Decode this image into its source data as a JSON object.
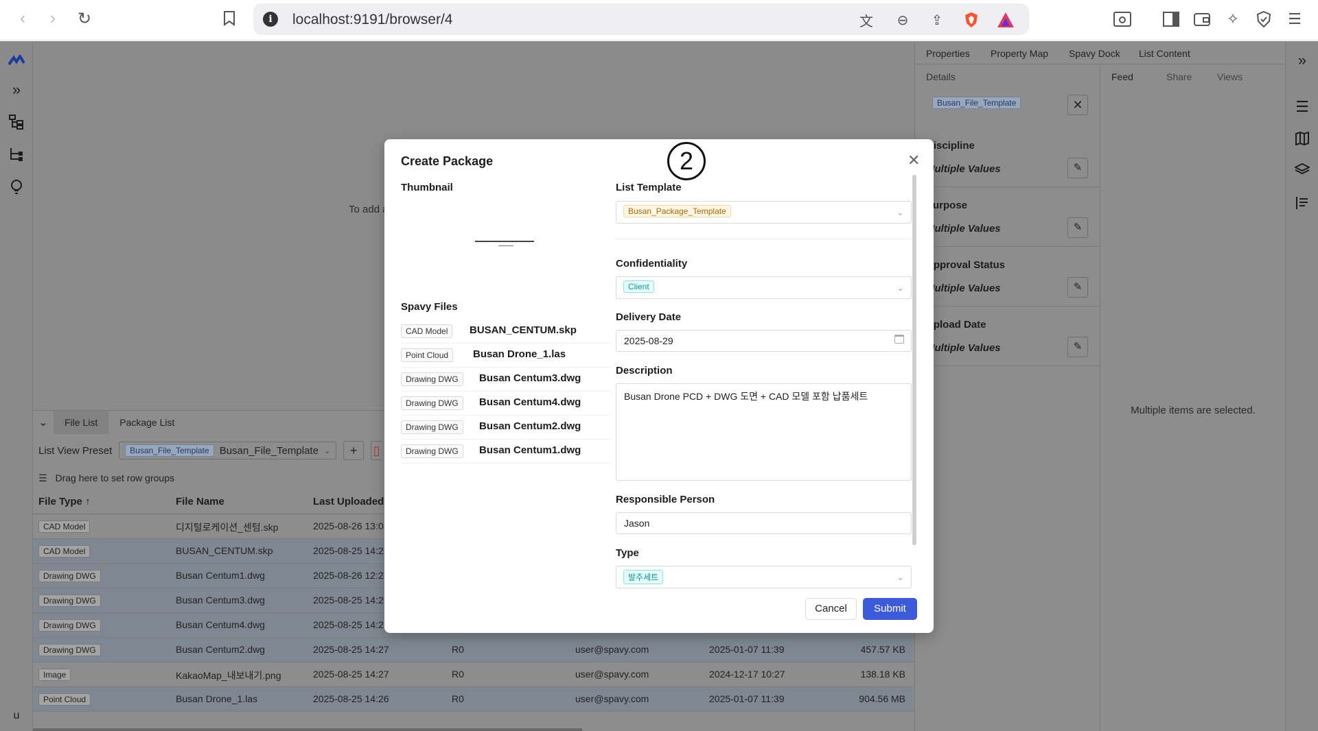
{
  "browser": {
    "url": "localhost:9191/browser/4"
  },
  "viewer": {
    "hint": "To add a"
  },
  "bottom_panel": {
    "tabs": [
      "File List",
      "Package List"
    ],
    "preset_label": "List View Preset",
    "preset_tag": "Busan_File_Template",
    "preset_value": "Busan_File_Template",
    "group_hint": "Drag here to set row groups",
    "columns": [
      "File Type",
      "File Name",
      "Last Uploaded"
    ],
    "rows": [
      {
        "type": "CAD Model",
        "name": "디지털로케이션_센텀.skp",
        "uploaded": "2025-08-26 13:0",
        "rev": "",
        "user": "",
        "date": "",
        "size": "",
        "selected": false
      },
      {
        "type": "CAD Model",
        "name": "BUSAN_CENTUM.skp",
        "uploaded": "2025-08-25 14:2",
        "rev": "",
        "user": "",
        "date": "",
        "size": "",
        "selected": true
      },
      {
        "type": "Drawing DWG",
        "name": "Busan Centum1.dwg",
        "uploaded": "2025-08-26 12:2",
        "rev": "",
        "user": "",
        "date": "",
        "size": "",
        "selected": true
      },
      {
        "type": "Drawing DWG",
        "name": "Busan Centum3.dwg",
        "uploaded": "2025-08-25 14:2",
        "rev": "",
        "user": "",
        "date": "",
        "size": "",
        "selected": true
      },
      {
        "type": "Drawing DWG",
        "name": "Busan Centum4.dwg",
        "uploaded": "2025-08-25 14:2",
        "rev": "",
        "user": "",
        "date": "",
        "size": "",
        "selected": true
      },
      {
        "type": "Drawing DWG",
        "name": "Busan Centum2.dwg",
        "uploaded": "2025-08-25 14:27",
        "rev": "R0",
        "user": "user@spavy.com",
        "date": "2025-01-07 11:39",
        "size": "457.57 KB",
        "selected": true
      },
      {
        "type": "Image",
        "name": "KakaoMap_내보내기.png",
        "uploaded": "2025-08-25 14:27",
        "rev": "R0",
        "user": "user@spavy.com",
        "date": "2024-12-17 10:27",
        "size": "138.18 KB",
        "selected": false
      },
      {
        "type": "Point Cloud",
        "name": "Busan Drone_1.las",
        "uploaded": "2025-08-25 14:26",
        "rev": "R0",
        "user": "user@spavy.com",
        "date": "2025-01-07 11:39",
        "size": "904.56 MB",
        "selected": true
      }
    ]
  },
  "right_panel": {
    "tabs": [
      "Properties",
      "Property Map",
      "Spavy Dock",
      "List Content"
    ],
    "sub_left": "Details",
    "sub_right": [
      "Feed",
      "Share",
      "Views"
    ],
    "template_tag": "Busan_File_Template",
    "properties": [
      {
        "name": "Discipline",
        "value": "Multiple Values"
      },
      {
        "name": "Purpose",
        "value": "Multiple Values"
      },
      {
        "name": "Approval Status",
        "value": "Multiple Values"
      },
      {
        "name": "Upload Date",
        "value": "Multiple Values"
      }
    ],
    "message": "Multiple items are selected."
  },
  "left_rail": {
    "bottom_letter": "u"
  },
  "modal": {
    "title": "Create Package",
    "step_marker": "2",
    "thumbnail_label": "Thumbnail",
    "spavy_files_label": "Spavy Files",
    "files": [
      {
        "type": "CAD Model",
        "name": "BUSAN_CENTUM.skp"
      },
      {
        "type": "Point Cloud",
        "name": "Busan Drone_1.las"
      },
      {
        "type": "Drawing DWG",
        "name": "Busan Centum3.dwg"
      },
      {
        "type": "Drawing DWG",
        "name": "Busan Centum4.dwg"
      },
      {
        "type": "Drawing DWG",
        "name": "Busan Centum2.dwg"
      },
      {
        "type": "Drawing DWG",
        "name": "Busan Centum1.dwg"
      }
    ],
    "list_template_label": "List Template",
    "list_template_value": "Busan_Package_Template",
    "confidentiality_label": "Confidentiality",
    "confidentiality_value": "Client",
    "delivery_date_label": "Delivery Date",
    "delivery_date_value": "2025-08-29",
    "description_label": "Description",
    "description_value": "Busan Drone PCD + DWG 도면 + CAD 모델 포함 납품세트",
    "responsible_label": "Responsible Person",
    "responsible_value": "Jason",
    "type_label": "Type",
    "type_value": "발주세트",
    "cancel_label": "Cancel",
    "submit_label": "Submit"
  }
}
